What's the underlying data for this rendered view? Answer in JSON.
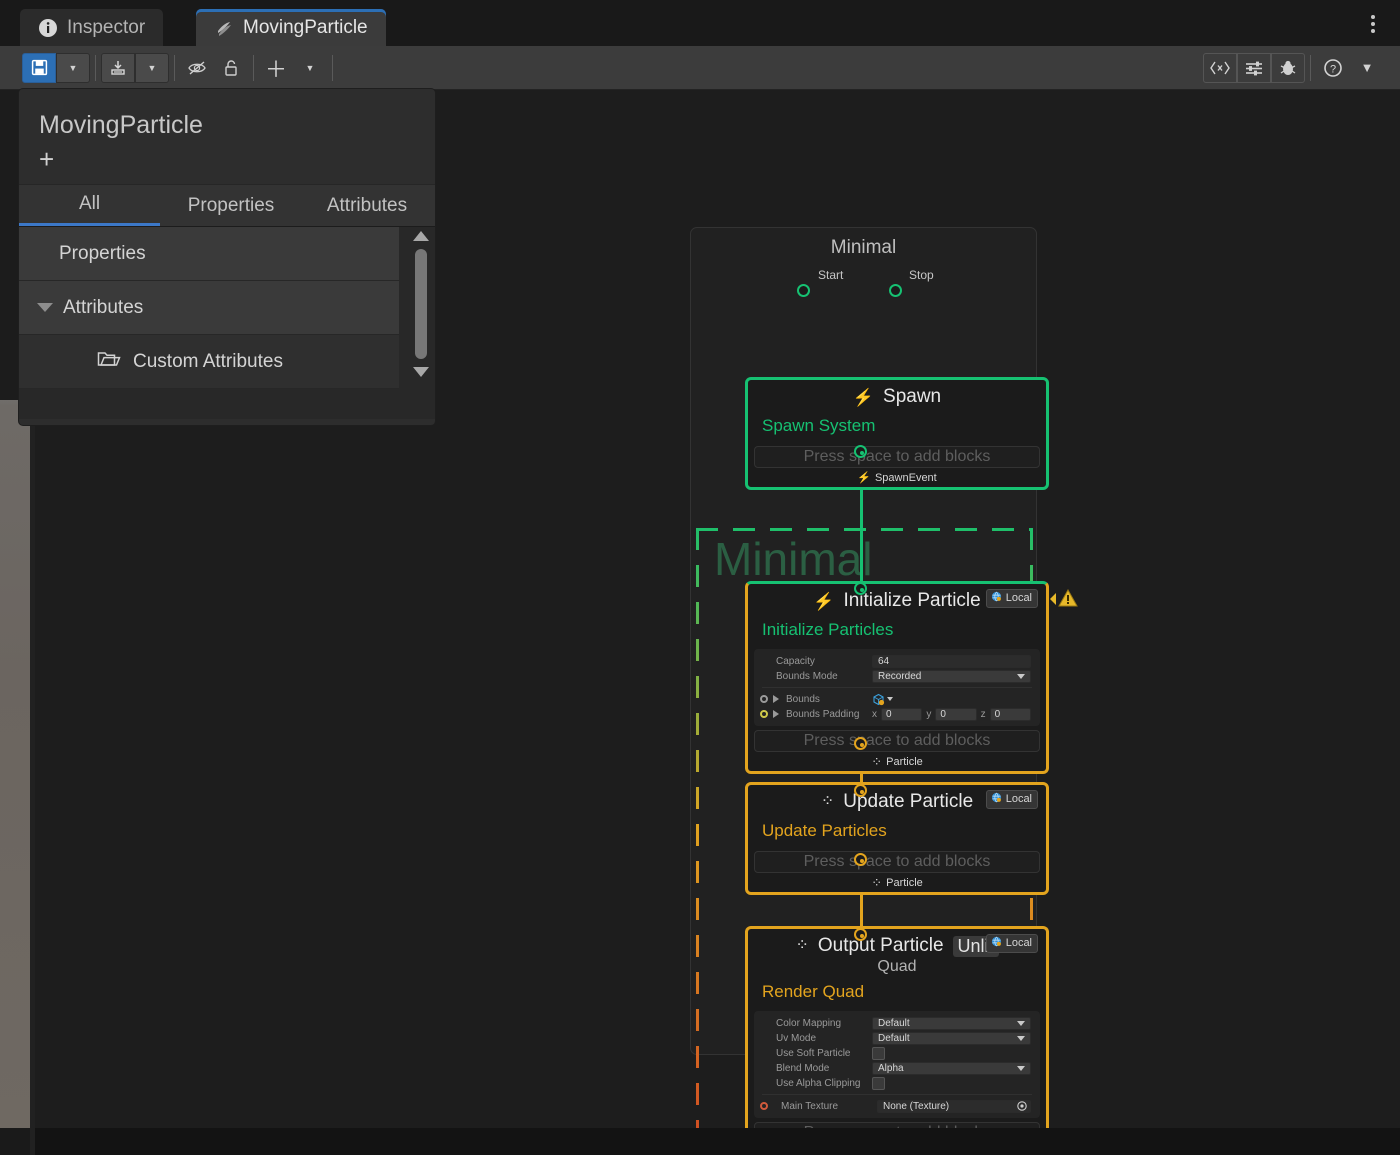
{
  "window": {
    "tabs": [
      {
        "label": "Inspector",
        "icon": "info-icon",
        "active": false
      },
      {
        "label": "MovingParticle",
        "icon": "vfx-graph-icon",
        "active": true
      }
    ],
    "menu_icon": "kebab-menu-icon"
  },
  "toolbar": {
    "left_buttons": [
      {
        "name": "save-button",
        "icon": "floppy-save-icon",
        "label": "💾"
      },
      {
        "name": "save-dropdown",
        "icon": "chevron-down-icon",
        "label": "▼"
      },
      {
        "name": "compile-button",
        "icon": "download-box-icon",
        "label": "⤓"
      },
      {
        "name": "compile-dropdown",
        "icon": "chevron-down-icon",
        "label": "▼"
      },
      {
        "name": "toggle-auto-compile-button",
        "icon": "eye-off-icon",
        "label": "⦸"
      },
      {
        "name": "lock-button",
        "icon": "unlock-icon",
        "label": "🔓"
      },
      {
        "name": "add-node-button",
        "icon": "plus-icon",
        "label": "＋"
      },
      {
        "name": "add-node-dropdown",
        "icon": "chevron-down-icon",
        "label": "▼"
      }
    ],
    "right_buttons": [
      {
        "name": "blackboard-button",
        "icon": "angle-brackets-x-icon",
        "label": "‹x›"
      },
      {
        "name": "parameters-button",
        "icon": "sliders-icon",
        "label": "☲"
      },
      {
        "name": "debug-button",
        "icon": "bug-icon",
        "label": "🐞"
      },
      {
        "name": "help-button",
        "icon": "question-mark-icon",
        "label": "?"
      },
      {
        "name": "help-dropdown",
        "icon": "chevron-down-icon",
        "label": "▼"
      }
    ]
  },
  "blackboard": {
    "title": "MovingParticle",
    "add_label": "+",
    "tabs": [
      {
        "label": "All",
        "active": true
      },
      {
        "label": "Properties",
        "active": false
      },
      {
        "label": "Attributes",
        "active": false
      }
    ],
    "rows": [
      {
        "label": "Properties",
        "has_triangle": false,
        "indent": false,
        "folder": false
      },
      {
        "label": "Attributes",
        "has_triangle": true,
        "indent": false,
        "folder": false
      },
      {
        "label": "Custom Attributes",
        "has_triangle": false,
        "indent": true,
        "folder": true
      }
    ],
    "scroll_up": "▲",
    "scroll_down": "▼"
  },
  "graph": {
    "group_title": "Minimal",
    "system_label": "Minimal",
    "colors": {
      "spawn_green": "#16c172",
      "particle_orange": "#e3a41e",
      "output_red": "#e05a2e",
      "accent_blue": "#2c6fb5"
    },
    "add_block_placeholder": "Press space to add blocks",
    "local_badge": "Local",
    "nodes": {
      "spawn": {
        "title": "Spawn",
        "icon": "lightning-icon",
        "subtitle": "Spawn System",
        "ports_in": [
          {
            "label": "Start"
          },
          {
            "label": "Stop"
          }
        ],
        "port_out": {
          "label": "SpawnEvent",
          "icon": "lightning-icon"
        }
      },
      "initialize": {
        "title": "Initialize Particle",
        "icon": "lightning-icon",
        "subtitle": "Initialize Particles",
        "badge": "Local",
        "warning_icon": "warning-triangle-icon",
        "properties": [
          {
            "label": "Capacity",
            "value": "64",
            "kind": "text"
          },
          {
            "label": "Bounds Mode",
            "value": "Recorded",
            "kind": "dropdown"
          }
        ],
        "exposed": [
          {
            "label": "Bounds",
            "dot": "white",
            "kind": "object",
            "value": ""
          },
          {
            "label": "Bounds Padding",
            "dot": "yellow",
            "kind": "vector3",
            "x": "0",
            "y": "0",
            "z": "0"
          }
        ],
        "port_out": {
          "label": "Particle",
          "icon": "particle-icon"
        }
      },
      "update": {
        "title": "Update Particle",
        "icon": "particle-icon",
        "subtitle": "Update Particles",
        "badge": "Local",
        "port_out": {
          "label": "Particle",
          "icon": "particle-icon"
        }
      },
      "output": {
        "title": "Output Particle",
        "title_chip": "Unlit",
        "subtitle_top": "Quad",
        "icon": "particle-icon",
        "subtitle": "Render Quad",
        "badge": "Local",
        "properties": [
          {
            "label": "Color Mapping",
            "value": "Default",
            "kind": "dropdown"
          },
          {
            "label": "Uv Mode",
            "value": "Default",
            "kind": "dropdown"
          },
          {
            "label": "Use Soft Particle",
            "value": "",
            "kind": "checkbox"
          },
          {
            "label": "Blend Mode",
            "value": "Alpha",
            "kind": "dropdown"
          },
          {
            "label": "Use Alpha Clipping",
            "value": "",
            "kind": "checkbox"
          }
        ],
        "exposed": [
          {
            "label": "Main Texture",
            "dot": "red",
            "kind": "object",
            "value": "None (Texture)"
          }
        ]
      }
    }
  }
}
